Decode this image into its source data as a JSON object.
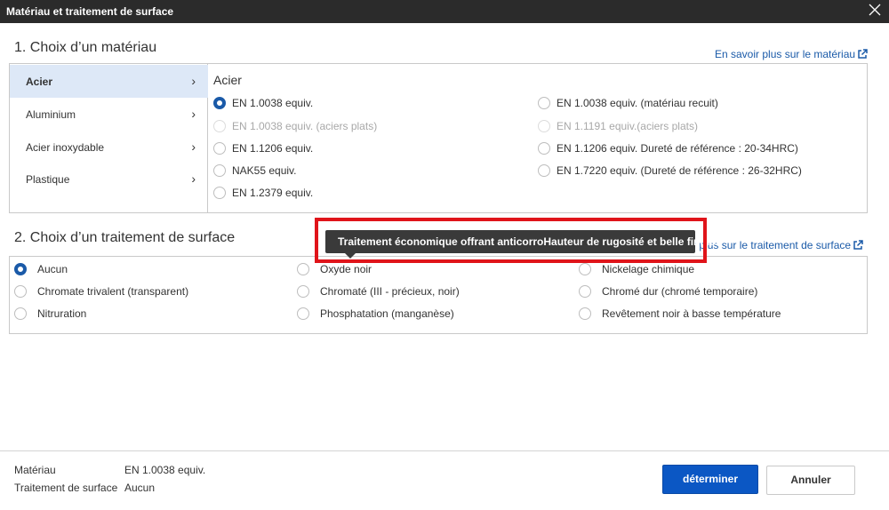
{
  "window": {
    "title": "Matériau et traitement de surface",
    "close_icon": "close-icon"
  },
  "material": {
    "section_title": "1. Choix d’un matériau",
    "learn_more": "En savoir plus sur le matériau",
    "categories": [
      {
        "label": "Acier",
        "active": true
      },
      {
        "label": "Aluminium",
        "active": false
      },
      {
        "label": "Acier inoxydable",
        "active": false
      },
      {
        "label": "Plastique",
        "active": false
      }
    ],
    "panel_title": "Acier",
    "options": [
      {
        "label": "EN 1.0038 equiv.",
        "checked": true,
        "disabled": false
      },
      {
        "label": "EN 1.0038 equiv. (matériau recuit)",
        "checked": false,
        "disabled": false
      },
      {
        "label": "EN 1.0038 equiv. (aciers plats)",
        "checked": false,
        "disabled": true
      },
      {
        "label": "EN 1.1191 equiv.(aciers plats)",
        "checked": false,
        "disabled": true
      },
      {
        "label": "EN 1.1206 equiv.",
        "checked": false,
        "disabled": false
      },
      {
        "label": "EN 1.1206 equiv. Dureté de référence : 20-34HRC)",
        "checked": false,
        "disabled": false
      },
      {
        "label": "NAK55 equiv.",
        "checked": false,
        "disabled": false
      },
      {
        "label": "EN 1.7220 equiv. (Dureté de référence : 26-32HRC)",
        "checked": false,
        "disabled": false
      },
      {
        "label": "EN 1.2379 equiv.",
        "checked": false,
        "disabled": false
      }
    ]
  },
  "surface": {
    "section_title": "2. Choix d’un traitement de surface",
    "learn_more": "En savoir plus sur le traitement de surface",
    "options": [
      {
        "label": "Aucun",
        "checked": true
      },
      {
        "label": "Oxyde noir",
        "checked": false
      },
      {
        "label": "Nickelage chimique",
        "checked": false
      },
      {
        "label": "Chromate trivalent (transparent)",
        "checked": false
      },
      {
        "label": "Chromaté (III - précieux, noir)",
        "checked": false
      },
      {
        "label": "Chromé dur (chromé temporaire)",
        "checked": false
      },
      {
        "label": "Nitruration",
        "checked": false
      },
      {
        "label": "Phosphatation (manganèse)",
        "checked": false
      },
      {
        "label": "Revêtement noir à basse température",
        "checked": false
      }
    ],
    "tooltip": "Traitement économique offrant anticorroHauteur de rugosité et belle finition"
  },
  "summary": {
    "material_label": "Matériau",
    "material_value": "EN 1.0038 equiv.",
    "surface_label": "Traitement de surface",
    "surface_value": "Aucun"
  },
  "buttons": {
    "confirm": "déterminer",
    "cancel": "Annuler"
  },
  "colors": {
    "accent": "#0b57c4",
    "link": "#1a5aa8",
    "highlight": "#e0141a",
    "active_bg": "#dde8f7"
  }
}
